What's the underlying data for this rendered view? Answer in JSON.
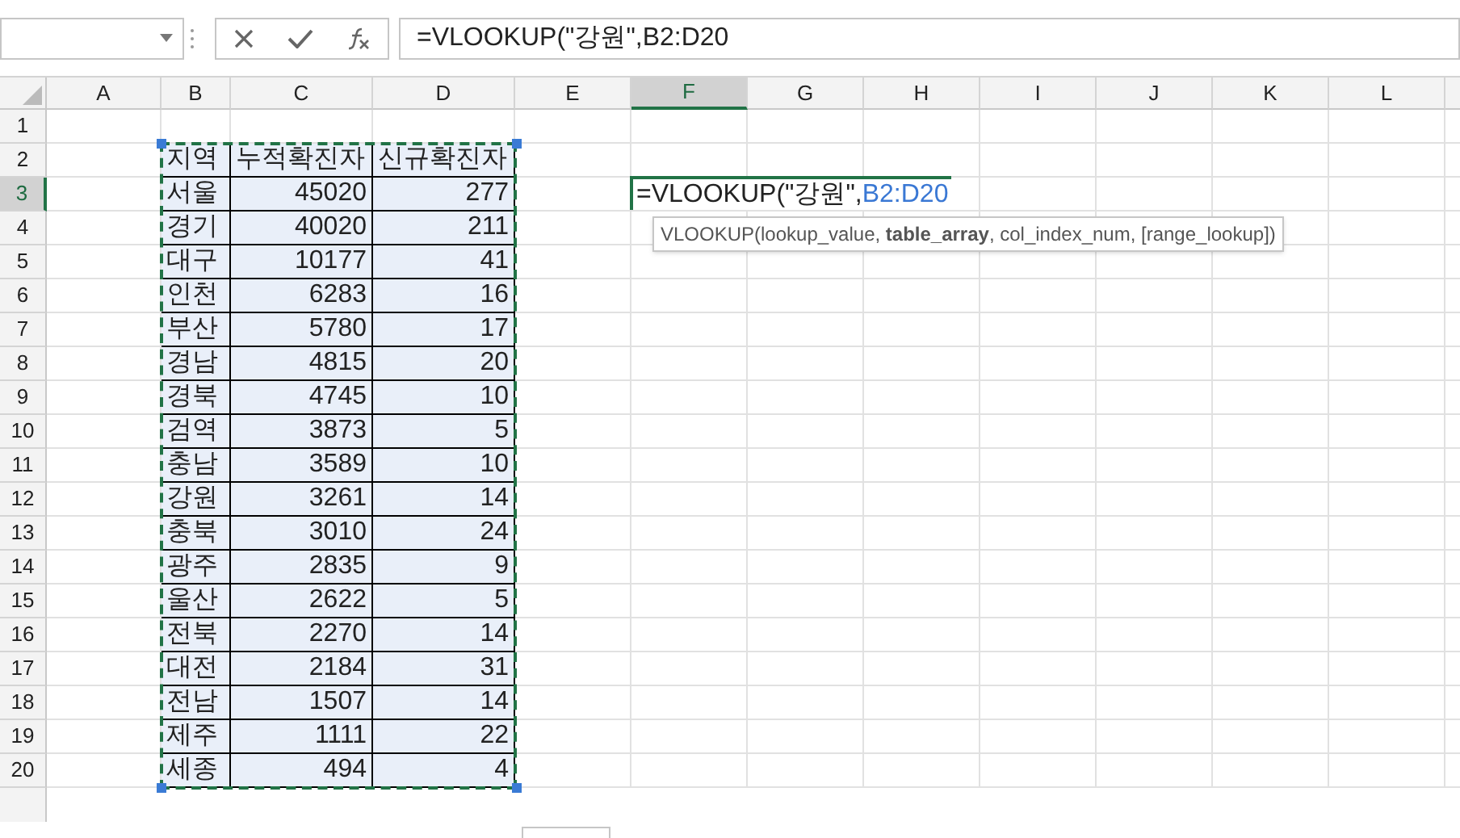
{
  "formula_bar": {
    "formula": "=VLOOKUP(\"강원\",B2:D20"
  },
  "columns": [
    {
      "label": "A",
      "selected": false
    },
    {
      "label": "B",
      "selected": false
    },
    {
      "label": "C",
      "selected": false
    },
    {
      "label": "D",
      "selected": false
    },
    {
      "label": "E",
      "selected": false
    },
    {
      "label": "F",
      "selected": true
    },
    {
      "label": "G",
      "selected": false
    },
    {
      "label": "H",
      "selected": false
    },
    {
      "label": "I",
      "selected": false
    },
    {
      "label": "J",
      "selected": false
    },
    {
      "label": "K",
      "selected": false
    },
    {
      "label": "L",
      "selected": false
    }
  ],
  "rows": [
    {
      "label": "1",
      "selected": false
    },
    {
      "label": "2",
      "selected": false
    },
    {
      "label": "3",
      "selected": true
    },
    {
      "label": "4",
      "selected": false
    },
    {
      "label": "5",
      "selected": false
    },
    {
      "label": "6",
      "selected": false
    },
    {
      "label": "7",
      "selected": false
    },
    {
      "label": "8",
      "selected": false
    },
    {
      "label": "9",
      "selected": false
    },
    {
      "label": "10",
      "selected": false
    },
    {
      "label": "11",
      "selected": false
    },
    {
      "label": "12",
      "selected": false
    },
    {
      "label": "13",
      "selected": false
    },
    {
      "label": "14",
      "selected": false
    },
    {
      "label": "15",
      "selected": false
    },
    {
      "label": "16",
      "selected": false
    },
    {
      "label": "17",
      "selected": false
    },
    {
      "label": "18",
      "selected": false
    },
    {
      "label": "19",
      "selected": false
    },
    {
      "label": "20",
      "selected": false
    }
  ],
  "table": [
    [
      "지역",
      "누적확진자",
      "신규확진자"
    ],
    [
      "서울",
      "45020",
      "277"
    ],
    [
      "경기",
      "40020",
      "211"
    ],
    [
      "대구",
      "10177",
      "41"
    ],
    [
      "인천",
      "6283",
      "16"
    ],
    [
      "부산",
      "5780",
      "17"
    ],
    [
      "경남",
      "4815",
      "20"
    ],
    [
      "경북",
      "4745",
      "10"
    ],
    [
      "검역",
      "3873",
      "5"
    ],
    [
      "충남",
      "3589",
      "10"
    ],
    [
      "강원",
      "3261",
      "14"
    ],
    [
      "충북",
      "3010",
      "24"
    ],
    [
      "광주",
      "2835",
      "9"
    ],
    [
      "울산",
      "2622",
      "5"
    ],
    [
      "전북",
      "2270",
      "14"
    ],
    [
      "대전",
      "2184",
      "31"
    ],
    [
      "전남",
      "1507",
      "14"
    ],
    [
      "제주",
      "1111",
      "22"
    ],
    [
      "세종",
      "494",
      "4"
    ]
  ],
  "active_cell": {
    "formula_text": "=VLOOKUP(\"강원\",",
    "reference": "B2:D20"
  },
  "tooltip": "VLOOKUP(lookup_value, **table_array**, col_index_num, [range_lookup])"
}
